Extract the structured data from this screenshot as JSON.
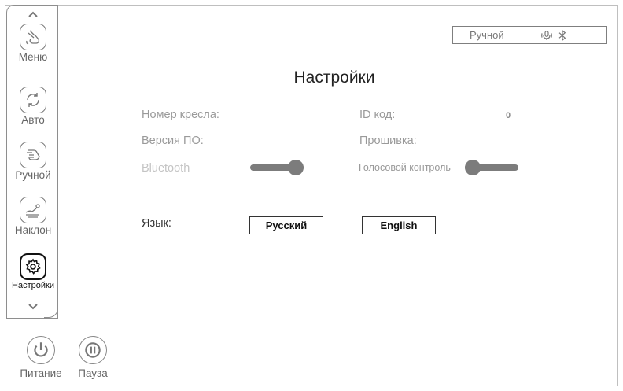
{
  "sidebar": {
    "items": [
      {
        "label": "Меню",
        "icon": "hand-menu-icon"
      },
      {
        "label": "Авто",
        "icon": "auto-rotate-icon"
      },
      {
        "label": "Ручной",
        "icon": "hand-manual-icon"
      },
      {
        "label": "Наклон",
        "icon": "recline-icon"
      },
      {
        "label": "Настройки",
        "icon": "gear-icon",
        "active": true
      }
    ]
  },
  "bottom": {
    "power_label": "Питание",
    "pause_label": "Пауза"
  },
  "status": {
    "mode": "Ручной",
    "icons": [
      "voice-icon",
      "bluetooth-icon"
    ]
  },
  "settings": {
    "title": "Настройки",
    "chair_number_label": "Номер кресла:",
    "id_code_label": "ID код:",
    "id_code_value": "0",
    "software_version_label": "Версия ПО:",
    "firmware_label": "Прошивка:",
    "bluetooth_label": "Bluetooth",
    "bluetooth_on": true,
    "voice_control_label": "Голосовой контроль",
    "voice_control_on": false,
    "language_label": "Язык:",
    "language_options": [
      "Русский",
      "English"
    ]
  }
}
